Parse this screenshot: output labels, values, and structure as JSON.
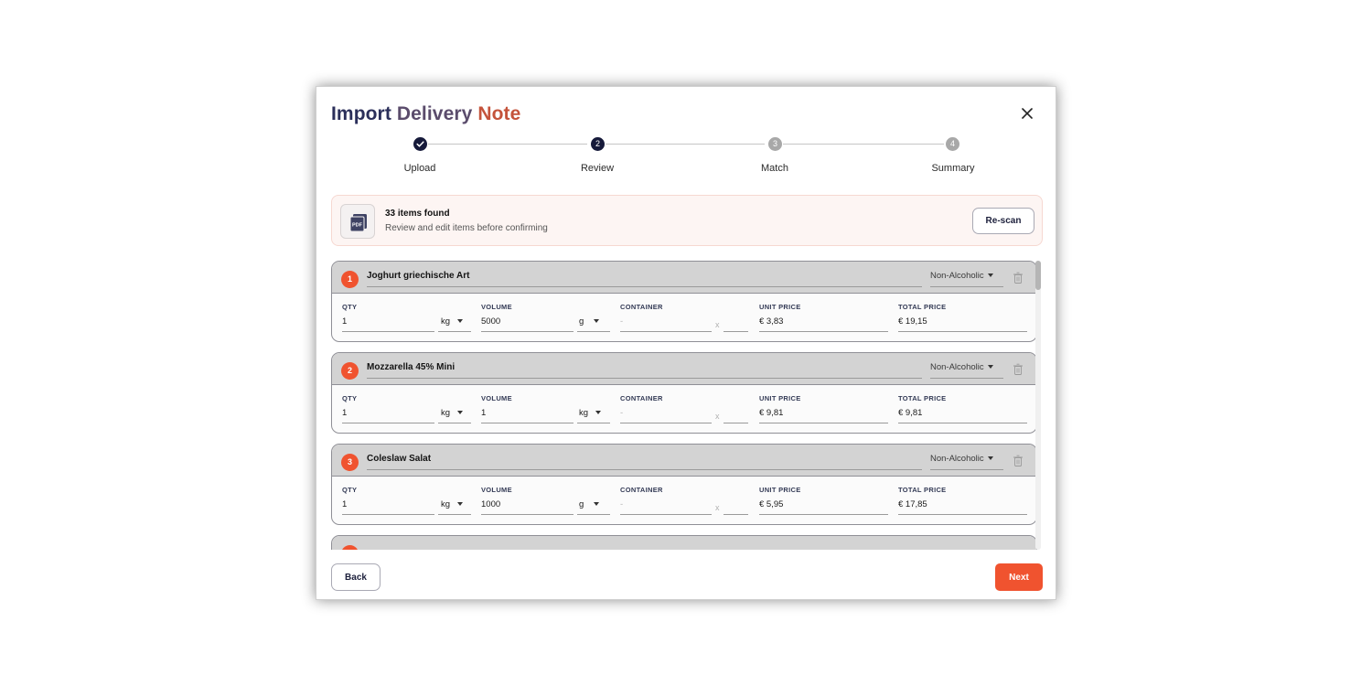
{
  "modal": {
    "title_part1": "Import",
    "title_part2": "Delivery",
    "title_part3": "Note",
    "close_icon": "close-icon"
  },
  "stepper": {
    "steps": [
      {
        "label": "Upload",
        "number": "1",
        "state": "done"
      },
      {
        "label": "Review",
        "number": "2",
        "state": "active"
      },
      {
        "label": "Match",
        "number": "3",
        "state": "todo"
      },
      {
        "label": "Summary",
        "number": "4",
        "state": "todo"
      }
    ]
  },
  "found": {
    "icon": "pdf-icon",
    "title": "33 items found",
    "subtitle": "Review and edit items before confirming",
    "rescan_label": "Re-scan"
  },
  "field_labels": {
    "qty": "QTY",
    "volume": "VOLUME",
    "container": "CONTAINER",
    "unit_price": "UNIT PRICE",
    "total_price": "TOTAL PRICE",
    "x": "x"
  },
  "items": [
    {
      "number": "1",
      "name": "Joghurt griechische Art",
      "category": "Non-Alcoholic",
      "qty": "1",
      "qty_unit": "kg",
      "volume": "5000",
      "volume_unit": "g",
      "container": "-",
      "unit_price": "€ 3,83",
      "total_price": "€ 19,15"
    },
    {
      "number": "2",
      "name": "Mozzarella 45% Mini",
      "category": "Non-Alcoholic",
      "qty": "1",
      "qty_unit": "kg",
      "volume": "1",
      "volume_unit": "kg",
      "container": "-",
      "unit_price": "€ 9,81",
      "total_price": "€ 9,81"
    },
    {
      "number": "3",
      "name": "Coleslaw Salat",
      "category": "Non-Alcoholic",
      "qty": "1",
      "qty_unit": "kg",
      "volume": "1000",
      "volume_unit": "g",
      "container": "-",
      "unit_price": "€ 5,95",
      "total_price": "€ 17,85"
    }
  ],
  "footer": {
    "back_label": "Back",
    "next_label": "Next"
  },
  "colors": {
    "accent": "#f0532f",
    "navy": "#161a3a"
  }
}
